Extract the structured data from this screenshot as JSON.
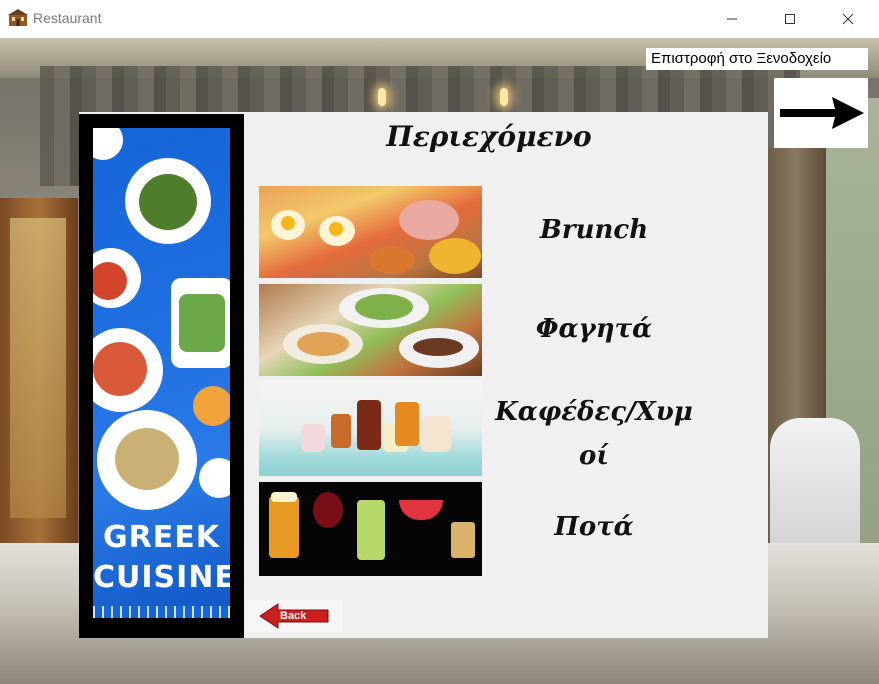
{
  "window": {
    "title": "Restaurant",
    "icon": "restaurant-building-icon",
    "controls": [
      "minimize-icon",
      "maximize-icon",
      "close-icon"
    ]
  },
  "header": {
    "return_link": "Επιστροφή στο Ξενοδοχείο",
    "forward_icon": "arrow-right-icon"
  },
  "panel": {
    "title": "Περιεχόμενο",
    "poster": {
      "line1": "GREEK",
      "line2": "CUISINE"
    },
    "menu": [
      {
        "label": "Brunch",
        "image": "brunch-photo"
      },
      {
        "label": "Φαγητά",
        "image": "food-photo"
      },
      {
        "label_line1": "Καφέδες/Χυμ",
        "label_line2": "οί",
        "image": "coffee-juice-photo"
      },
      {
        "label": "Ποτά",
        "image": "drinks-photo"
      }
    ],
    "back_button": "Back"
  },
  "colors": {
    "panel_bg": "#f0f0f0",
    "poster_blue": "#1565d8",
    "back_red": "#cc1f1f"
  }
}
